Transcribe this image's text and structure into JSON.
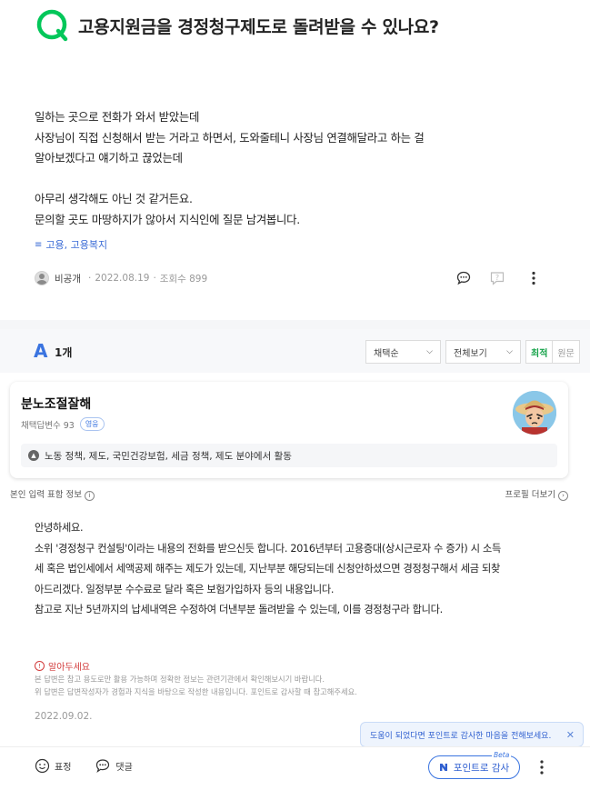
{
  "question": {
    "title": "고용지원금을 경정청구제도로 돌려받을 수 있나요?",
    "body_lines": [
      "일하는 곳으로 전화가 와서 받았는데",
      "사장님이 직접 신청해서 받는 거라고 하면서, 도와줄테니 사장님 연결해달라고 하는 걸",
      "알아보겠다고 얘기하고 끊었는데",
      "",
      "아무리 생각해도 아닌 것 같거든요.",
      "문의할 곳도 마땅하지가 않아서 지식인에 질문 남겨봅니다."
    ],
    "tag": "고용, 고용복지",
    "author": "비공개",
    "date": "2022.08.19",
    "views": "조회수 899"
  },
  "answers_bar": {
    "letter": "A",
    "count": "1개",
    "sort_select": "채택순",
    "view_select": "전체보기",
    "toggle_on": "최적",
    "toggle_off": "원문"
  },
  "answerer": {
    "name": "분노조절잘해",
    "adopted": "채택답변수 93",
    "badge": "영웅",
    "field": "노동 정책, 제도, 국민건강보험, 세금 정책, 제도 분야에서 활동"
  },
  "info_row": {
    "left": "본인 입력 표함 정보",
    "right": "프로필 더보기"
  },
  "answer": {
    "body_lines": [
      "안녕하세요.",
      "소위 '경정청구 컨설팅'이라는 내용의 전화를 받으신듯 합니다. 2016년부터 고용증대(상시근로자 수 증가) 시 소득",
      "세 혹은 법인세에서 세액공제 해주는 제도가 있는데, 지난부분 해당되는데 신청안하셨으면 경정청구해서 세금 되찾",
      "아드리겠다. 일정부분 수수료로 달라 혹은 보험가입하자 등의 내용입니다.",
      "참고로 지난 5년까지의 납세내역은 수정하여 더낸부분 돌려받을 수 있는데, 이를 경정청구라 합니다."
    ],
    "notice_title": "알아두세요",
    "notice_lines": [
      "본 답변은 참고 용도로만 활용 가능하며 정확한 정보는 관련기관에서 확인해보시기 바랍니다.",
      "위 답변은 답변작성자가 경험과 지식을 바탕으로 작성한 내용입니다. 포인트로 감사할 때 참고해주세요."
    ],
    "date": "2022.09.02."
  },
  "tooltip": {
    "text": "도움이 되었다면 포인트로 감사한 마음을 전해보세요."
  },
  "bottom": {
    "reaction": "표정",
    "comment": "댓글",
    "thank_button": "포인트로 감사",
    "beta": "Beta"
  },
  "colors": {
    "brand_green": "#03c75a",
    "link_blue": "#3a6bd6",
    "alert_red": "#d23b3b"
  }
}
